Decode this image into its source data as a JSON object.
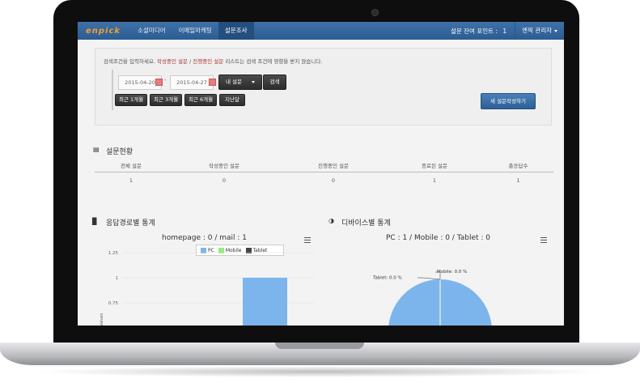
{
  "nav": {
    "logo": "enpick",
    "items": [
      "소셜미디어",
      "이메일마케팅",
      "설문조사"
    ],
    "active_index": 2,
    "points_label": "설문 잔여 포인트 :",
    "points_value": "1",
    "admin_label": "엔픽 관리자"
  },
  "search": {
    "notice_pre": "검색조건을 입력하세요.",
    "notice_red1": "작성중인 설문",
    "notice_slash": " / ",
    "notice_red2": "진행중인 설문",
    "notice_post": "리스트는 검색 조건에 영향을 받지 않습니다.",
    "date_from": "2015-04-20",
    "date_to": "2015-04-27",
    "scope_select": "내 설문",
    "search_button": "검색",
    "ranges": [
      "최근 1개월",
      "최근 3개월",
      "최근 6개월",
      "지난달"
    ],
    "new_survey_button": "새 설문작성하기"
  },
  "stats": {
    "title": "설문현황",
    "headers": [
      "전체 설문",
      "작성중인 설문",
      "진행중인 설문",
      "종료된 설문",
      "총응답수"
    ],
    "values": [
      "1",
      "0",
      "0",
      "1",
      "1"
    ]
  },
  "route_chart": {
    "section_title": "응답경로별 통계",
    "subtitle": "homepage : 0 / mail : 1",
    "legend": [
      {
        "name": "PC",
        "color": "#7cb5ec"
      },
      {
        "name": "Mobile",
        "color": "#90ed7d"
      },
      {
        "name": "Tablet",
        "color": "#434348"
      }
    ],
    "yaxis_label": "Values"
  },
  "device_chart": {
    "section_title": "디바이스별 통계",
    "subtitle": "PC : 1 / Mobile : 0 / Tablet : 0",
    "label_mobile": "Mobile: 0.0 %",
    "label_tablet": "Tablet: 0.0 %"
  },
  "chart_data": [
    {
      "type": "bar",
      "title": "homepage : 0 / mail : 1",
      "ylabel": "Values",
      "ylim": [
        0.75,
        1.25
      ],
      "yticks": [
        "1.25",
        "1",
        "0.75"
      ],
      "series": [
        {
          "name": "PC",
          "values": [
            1
          ],
          "color": "#7cb5ec"
        }
      ],
      "legend": [
        "PC",
        "Mobile",
        "Tablet"
      ],
      "legend_position": "top"
    },
    {
      "type": "pie",
      "title": "PC : 1 / Mobile : 0 / Tablet : 0",
      "slices": [
        {
          "name": "PC",
          "value": 100.0,
          "color": "#7cb5ec"
        },
        {
          "name": "Mobile",
          "value": 0.0
        },
        {
          "name": "Tablet",
          "value": 0.0
        }
      ]
    }
  ]
}
